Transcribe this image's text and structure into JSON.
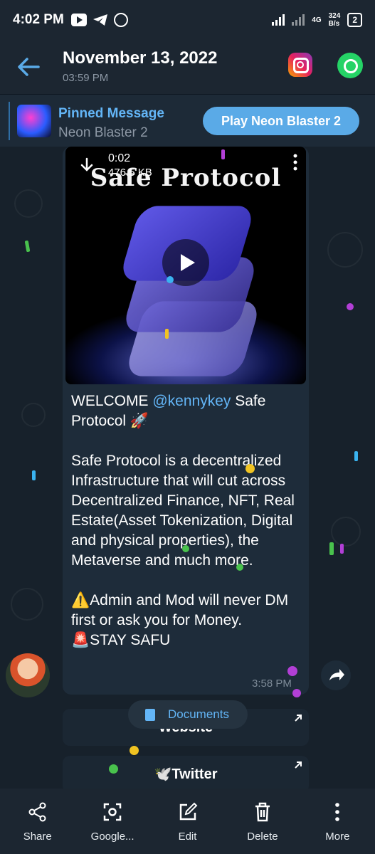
{
  "status_bar": {
    "time": "4:02 PM",
    "network": "4G",
    "speed": "324\nB/s",
    "battery": "2"
  },
  "header": {
    "title": "November 13, 2022",
    "subtitle": "03:59 PM"
  },
  "pinned": {
    "title": "Pinned Message",
    "subtitle": "Neon Blaster 2",
    "button": "Play Neon Blaster 2"
  },
  "message": {
    "video": {
      "duration": "0:02",
      "size": "476.5 KB",
      "title": "Safe Protocol"
    },
    "welcome": "WELCOME ",
    "mention": "@kennykey",
    "welcome_tail": " Safe Protocol 🚀",
    "paragraph2": "Safe Protocol is a decentralized Infrastructure that will cut across Decentralized Finance, NFT, Real Estate(Asset Tokenization, Digital and physical properties), the Metaverse and much more.",
    "paragraph3a": "⚠️Admin and Mod will never DM first or ask you for Money.",
    "paragraph3b": "🚨STAY SAFU",
    "time": "3:58 PM"
  },
  "buttons": {
    "website": "Website",
    "documents": "Documents",
    "twitter": "🕊️Twitter"
  },
  "bottom_bar": [
    {
      "label": "Share",
      "icon": "share-icon"
    },
    {
      "label": "Google...",
      "icon": "google-lens-icon"
    },
    {
      "label": "Edit",
      "icon": "edit-icon"
    },
    {
      "label": "Delete",
      "icon": "delete-icon"
    },
    {
      "label": "More",
      "icon": "more-icon"
    }
  ],
  "colors": {
    "accent": "#63b5f6",
    "header_bg": "#1c2631",
    "chat_bg": "#17212b",
    "bubble_bg": "#1e2c3a"
  }
}
